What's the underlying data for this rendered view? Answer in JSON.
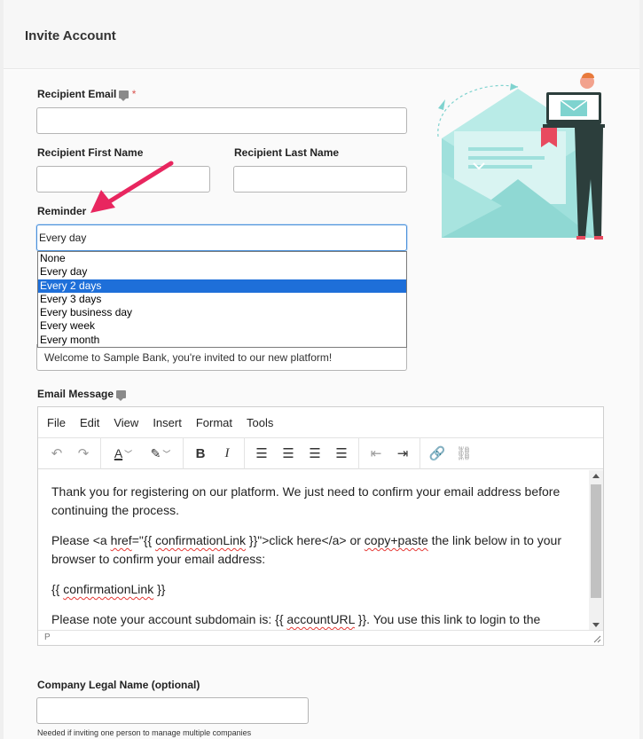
{
  "header": {
    "title": "Invite Account"
  },
  "form": {
    "recipient_email_label": "Recipient Email",
    "required_mark": "*",
    "recipient_email_value": "",
    "first_name_label": "Recipient First Name",
    "first_name_value": "",
    "last_name_label": "Recipient Last Name",
    "last_name_value": "",
    "reminder_label": "Reminder",
    "reminder_selected": "Every day",
    "reminder_options": [
      "None",
      "Every day",
      "Every 2 days",
      "Every 3 days",
      "Every business day",
      "Every week",
      "Every month"
    ],
    "reminder_highlighted": "Every 2 days",
    "subject_value": "Welcome to Sample Bank, you're invited to our new platform!",
    "email_message_label": "Email Message",
    "company_legal_name_label": "Company Legal Name (optional)",
    "company_legal_name_value": "",
    "company_help_text": "Needed if inviting one person to manage multiple companies"
  },
  "editor": {
    "menu": [
      "File",
      "Edit",
      "View",
      "Insert",
      "Format",
      "Tools"
    ],
    "toolbar_icons": [
      "undo-icon",
      "redo-icon",
      "text-color-icon",
      "highlight-color-icon",
      "bold-icon",
      "italic-icon",
      "align-left-icon",
      "align-center-icon",
      "align-right-icon",
      "align-justify-icon",
      "outdent-icon",
      "indent-icon",
      "link-icon",
      "unlink-icon"
    ],
    "paragraph_1": "Thank you for registering on our platform. We just need to confirm your email address before continuing the process.",
    "paragraph_2_a": "Please <a ",
    "paragraph_2_href": "href",
    "paragraph_2_b": "=\"{{ ",
    "paragraph_2_link": "confirmationLink",
    "paragraph_2_c": " }}\">click here</a> or ",
    "paragraph_2_copy": "copy+paste",
    "paragraph_2_d": " the link below in to your browser to confirm your email address:",
    "paragraph_3_a": "{{ ",
    "paragraph_3_link": "confirmationLink",
    "paragraph_3_b": " }}",
    "paragraph_4_a": "Please note your account subdomain is: {{ ",
    "paragraph_4_url": "accountURL",
    "paragraph_4_b": " }}. You use this link to login to the",
    "status_path": "P"
  },
  "colors": {
    "accent": "#1e6fd9",
    "teal": "#7fd3cf",
    "arrow": "#e8265f"
  }
}
